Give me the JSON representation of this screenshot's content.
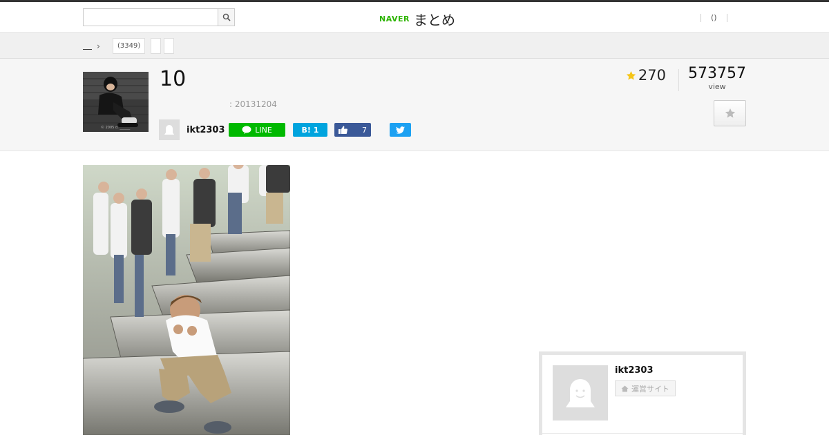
{
  "header": {
    "search": {
      "value": "",
      "placeholder": ""
    },
    "logo": {
      "naver": "NAVER",
      "matome": "まとめ"
    },
    "right_link": "()"
  },
  "breadcrumb": {
    "tags": [
      "(3349)",
      "",
      ""
    ]
  },
  "article": {
    "title": "10",
    "date": ": 20131204",
    "author": "ikt2303",
    "share": {
      "line": "LINE",
      "hatena": "B! 1",
      "facebook_count": "7"
    },
    "favorites": "270",
    "views": "573757",
    "views_label": "view"
  },
  "author_card": {
    "name": "ikt2303",
    "site_label": "運営サイト"
  },
  "colors": {
    "line": "#00b900",
    "hatena": "#00a4de",
    "facebook": "#3b5998",
    "twitter": "#1da1f2",
    "naver": "#2db400",
    "star": "#f5c518"
  }
}
